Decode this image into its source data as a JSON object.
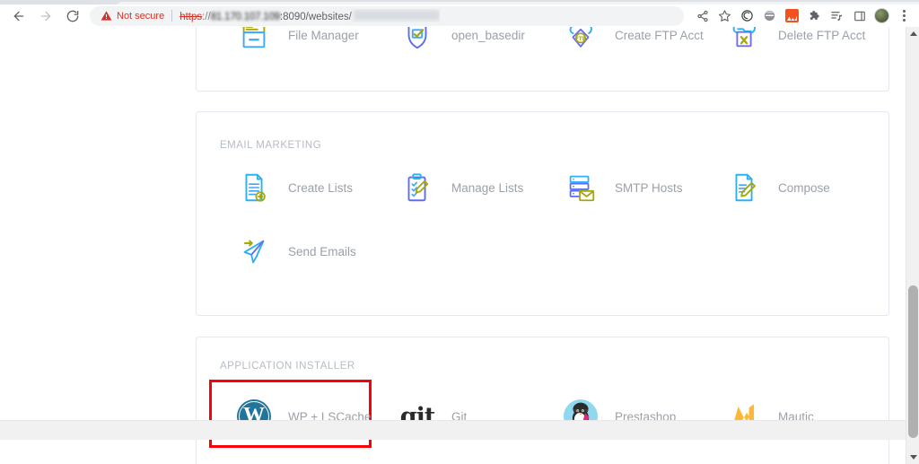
{
  "browser": {
    "nav": {
      "back": "Back",
      "forward": "Forward",
      "reload": "Reload"
    },
    "omnibox": {
      "security_label": "Not secure",
      "security_icon": "warning-triangle-icon",
      "url_scheme": "https",
      "url_separator": "://",
      "url_host": "81.170.107.109",
      "url_path": ":8090/websites/",
      "url_redacted": true
    },
    "actions": [
      {
        "name": "share-icon",
        "label": "Share"
      },
      {
        "name": "bookmark-star-icon",
        "label": "Bookmark this tab"
      },
      {
        "name": "extension-loom-icon",
        "label": "Loom"
      },
      {
        "name": "extension-grammarly-icon",
        "label": "Grammarly"
      },
      {
        "name": "extension-orange-icon",
        "label": "Extension"
      },
      {
        "name": "extensions-puzzle-icon",
        "label": "Extensions"
      },
      {
        "name": "reading-list-icon",
        "label": "Reading list"
      },
      {
        "name": "side-panel-icon",
        "label": "Side panel"
      },
      {
        "name": "avatar",
        "label": "Profile"
      },
      {
        "name": "chrome-menu-icon",
        "label": "Customize and control Google Chrome"
      }
    ]
  },
  "page": {
    "sections": [
      {
        "id": "files",
        "title": "",
        "title_visible": false,
        "tiles": [
          {
            "label": "File Manager",
            "icon": "file-manager-icon"
          },
          {
            "label": "open_basedir",
            "icon": "shield-check-icon"
          },
          {
            "label": "Create FTP Acct",
            "icon": "cloud-ftp-create-icon"
          },
          {
            "label": "Delete FTP Acct",
            "icon": "cloud-ftp-delete-icon"
          }
        ]
      },
      {
        "id": "email",
        "title": "EMAIL MARKETING",
        "title_visible": true,
        "tiles": [
          {
            "label": "Create Lists",
            "icon": "document-add-icon"
          },
          {
            "label": "Manage Lists",
            "icon": "clipboard-edit-icon"
          },
          {
            "label": "SMTP Hosts",
            "icon": "server-mail-icon"
          },
          {
            "label": "Compose",
            "icon": "document-pencil-icon"
          },
          {
            "label": "Send Emails",
            "icon": "paper-plane-icon"
          }
        ]
      },
      {
        "id": "installer",
        "title": "APPLICATION INSTALLER",
        "title_visible": true,
        "tiles": [
          {
            "label": "WP + LSCache",
            "icon": "wordpress-icon",
            "highlighted": true
          },
          {
            "label": "Git",
            "icon": "git-icon",
            "highlighted": false
          },
          {
            "label": "Prestashop",
            "icon": "prestashop-icon",
            "highlighted": false
          },
          {
            "label": "Mautic",
            "icon": "mautic-icon",
            "highlighted": false
          }
        ]
      }
    ],
    "highlight": {
      "color": "#fb0007",
      "target": "WP + LSCache"
    }
  },
  "colors": {
    "accent_blue": "#2bb2f4",
    "accent_violet": "#6d6df0",
    "accent_olive": "#a7a70a",
    "wordpress": "#21759b",
    "mautic": "#fdb933",
    "prestashop": "#8fd8ef",
    "label_gray": "#9aa1a9",
    "section_gray": "#b6bcc4",
    "highlight_red": "#fb0007",
    "not_secure_red": "#d93025"
  }
}
